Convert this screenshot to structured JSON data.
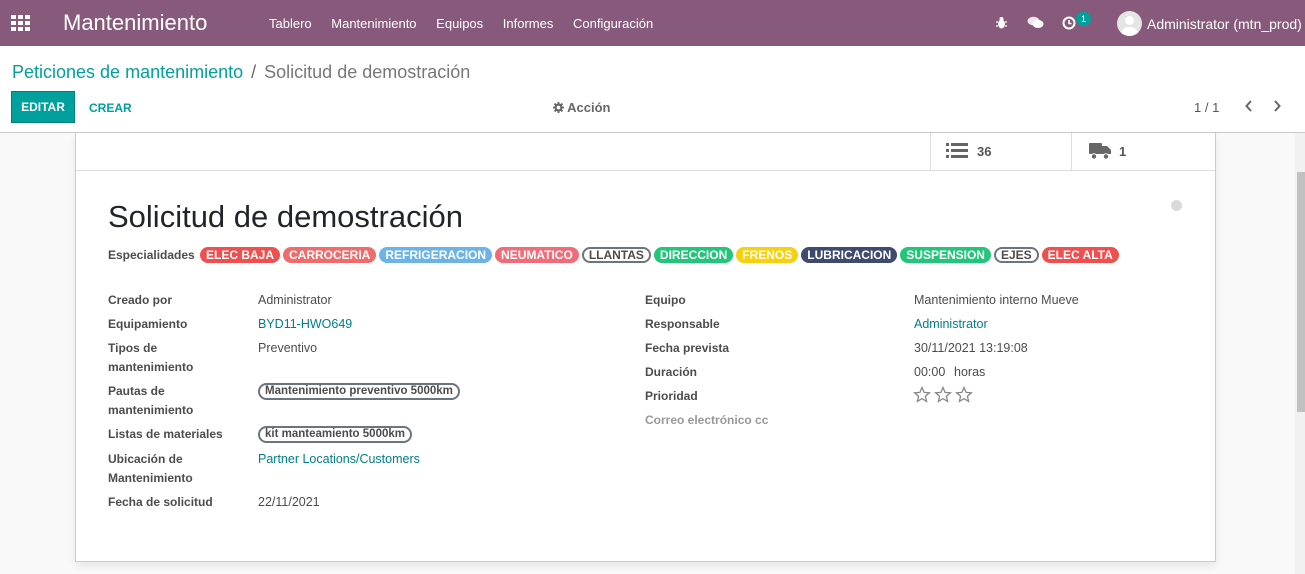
{
  "navbar": {
    "app_name": "Mantenimiento",
    "menu": [
      "Tablero",
      "Mantenimiento",
      "Equipos",
      "Informes",
      "Configuración"
    ],
    "activity_count": "1",
    "user": "Administrator (mtn_prod)",
    "color": "#875a7b"
  },
  "breadcrumb": {
    "parent": "Peticiones de mantenimiento",
    "separator": "/",
    "current": "Solicitud de demostración"
  },
  "toolbar": {
    "edit_label": "EDITAR",
    "create_label": "CREAR",
    "action_label": "Acción",
    "pager": "1 / 1",
    "prev_icon": "chevron-left-icon",
    "next_icon": "chevron-right-icon"
  },
  "smart_buttons": [
    {
      "icon": "list-icon",
      "value": "36"
    },
    {
      "icon": "truck-icon",
      "value": "1"
    }
  ],
  "record": {
    "title": "Solicitud de demostración",
    "specialties_label": "Especialidades",
    "specialties": [
      {
        "label": "ELEC BAJA",
        "color": "#f04f4f",
        "outline": false
      },
      {
        "label": "CARROCERIA",
        "color": "#f06c6c",
        "outline": false
      },
      {
        "label": "REFRIGERACION",
        "color": "#6cb4e8",
        "outline": false
      },
      {
        "label": "NEUMATICO",
        "color": "#f06c78",
        "outline": false
      },
      {
        "label": "LLANTAS",
        "color": "#ffffff",
        "outline": true
      },
      {
        "label": "DIRECCION",
        "color": "#22c57a",
        "outline": false
      },
      {
        "label": "FRENOS",
        "color": "#f5d10f",
        "outline": false
      },
      {
        "label": "LUBRICACION",
        "color": "#3e4a6e",
        "outline": false
      },
      {
        "label": "SUSPENSION",
        "color": "#22c57a",
        "outline": false
      },
      {
        "label": "EJES",
        "color": "#ffffff",
        "outline": true
      },
      {
        "label": "ELEC ALTA",
        "color": "#f04f4f",
        "outline": false
      }
    ],
    "left": {
      "created_by_label": "Creado por",
      "created_by": "Administrator",
      "equipment_label": "Equipamiento",
      "equipment": "BYD11-HWO649",
      "type_label_1": "Tipos de",
      "type_label_2": "mantenimiento",
      "type": "Preventivo",
      "guidelines_label_1": "Pautas de",
      "guidelines_label_2": "mantenimiento",
      "guidelines": "Mantenimiento preventivo 5000km",
      "materials_label": "Listas de materiales",
      "materials": "kit manteamiento 5000km",
      "location_label_1": "Ubicación de",
      "location_label_2": "Mantenimiento",
      "location": "Partner Locations/Customers",
      "request_date_label": "Fecha de solicitud",
      "request_date": "22/11/2021"
    },
    "right": {
      "team_label": "Equipo",
      "team": "Mantenimiento interno Mueve",
      "responsible_label": "Responsable",
      "responsible": "Administrator",
      "scheduled_label": "Fecha prevista",
      "scheduled": "30/11/2021 13:19:08",
      "duration_label": "Duración",
      "duration": "00:00",
      "duration_unit": "horas",
      "priority_label": "Prioridad",
      "priority_stars": 0,
      "priority_max": 3,
      "email_cc_label": "Correo electrónico cc"
    }
  }
}
